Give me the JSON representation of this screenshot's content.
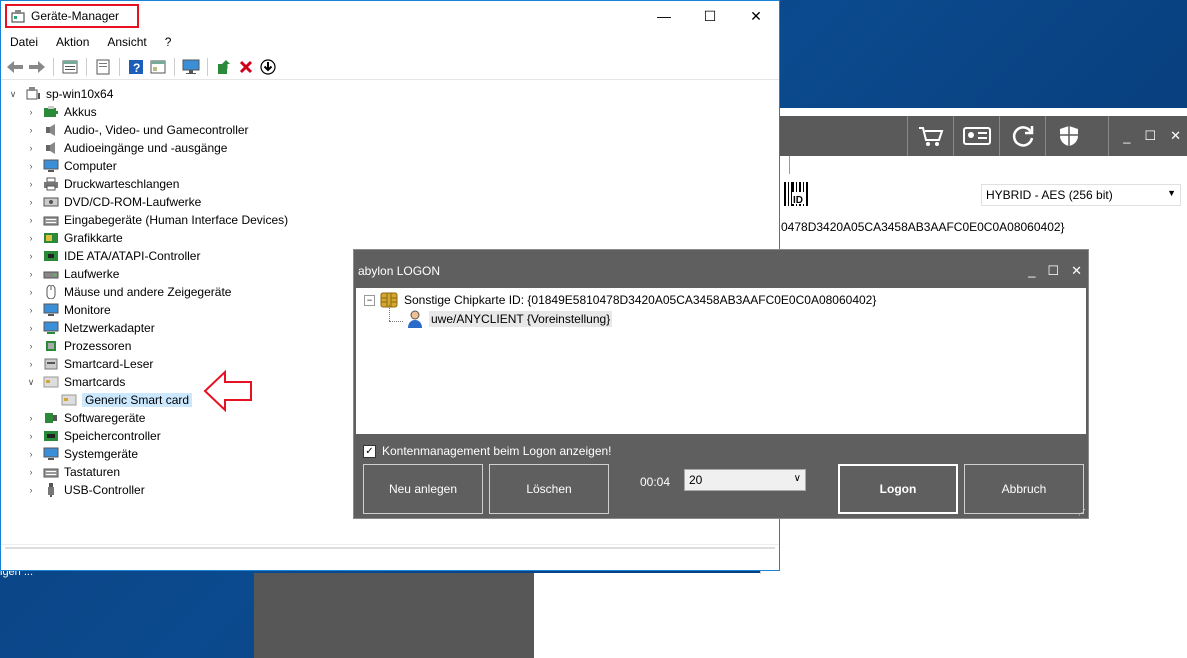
{
  "desktop": {
    "status_text": "igen ..."
  },
  "bg_app": {
    "encryption_select": "HYBRID - AES (256 bit)",
    "chip_id_fragment": "0478D3420A05CA3458AB3AAFC0E0C0A08060402}"
  },
  "device_manager": {
    "title": "Geräte-Manager",
    "menu": [
      "Datei",
      "Aktion",
      "Ansicht",
      "?"
    ],
    "root": "sp-win10x64",
    "categories": [
      "Akkus",
      "Audio-, Video- und Gamecontroller",
      "Audioeingänge und -ausgänge",
      "Computer",
      "Druckwarteschlangen",
      "DVD/CD-ROM-Laufwerke",
      "Eingabegeräte (Human Interface Devices)",
      "Grafikkarte",
      "IDE ATA/ATAPI-Controller",
      "Laufwerke",
      "Mäuse und andere Zeigegeräte",
      "Monitore",
      "Netzwerkadapter",
      "Prozessoren",
      "Smartcard-Leser",
      "Smartcards",
      "Softwaregeräte",
      "Speichercontroller",
      "Systemgeräte",
      "Tastaturen",
      "USB-Controller"
    ],
    "smartcard_child": "Generic Smart card"
  },
  "logon_dialog": {
    "title": "abylon LOGON",
    "chip_entry": "Sonstige Chipkarte ID: {01849E5810478D3420A05CA3458AB3AAFC0E0C0A08060402}",
    "user_entry": "uwe/ANYCLIENT {Voreinstellung}",
    "checkbox_label": "Kontenmanagement beim Logon anzeigen!",
    "checkbox_checked": true,
    "btn_new": "Neu anlegen",
    "btn_delete": "Löschen",
    "timer": "00:04",
    "timeout_value": "20",
    "btn_logon": "Logon",
    "btn_cancel": "Abbruch"
  },
  "colors": {
    "accent": "#1883d7",
    "highlight": "#cce8ff",
    "dialog_bg": "#5f5f5f",
    "red": "#e81123"
  }
}
